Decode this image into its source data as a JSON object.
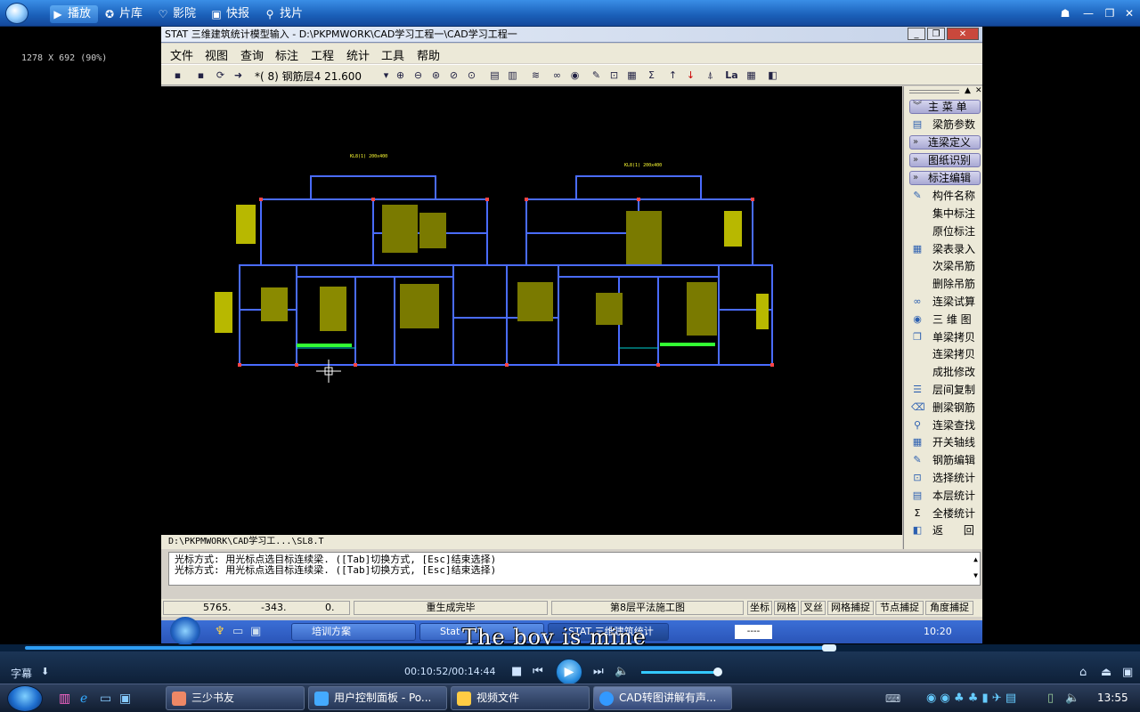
{
  "player": {
    "tabs": [
      {
        "label": "播放",
        "icon": "play-icon"
      },
      {
        "label": "片库",
        "icon": "library-icon"
      },
      {
        "label": "影院",
        "icon": "heart-icon"
      },
      {
        "label": "快报",
        "icon": "news-icon"
      },
      {
        "label": "找片",
        "icon": "search-icon"
      }
    ],
    "resolution": "1278 X 692 (90%)",
    "time": "00:10:52/00:14:44",
    "progress": 0.7375,
    "volume": 0.98,
    "subtitle_label": "字幕",
    "subtitle_text": "The boy is mine"
  },
  "stat": {
    "title": "STAT 三维建筑统计模型输入 - D:\\PKPMWORK\\CAD学习工程一\\CAD学习工程一",
    "menu": [
      "文件",
      "视图",
      "查询",
      "标注",
      "工程",
      "统计",
      "工具",
      "帮助"
    ],
    "layer_text": "*( 8)  钢筋层4   21.600",
    "file_path": "D:\\PKPMWORK\\CAD学习工...\\SL8.T",
    "side_heads": [
      "主 菜 单",
      "连梁定义",
      "图纸识别",
      "标注编辑"
    ],
    "side_first": "梁筋参数",
    "side_items": [
      "构件名称",
      "集中标注",
      "原位标注",
      "梁表录入",
      "次梁吊筋",
      "删除吊筋",
      "连梁试算",
      "三 维 图",
      "单梁拷贝",
      "连梁拷贝",
      "成批修改",
      "层间复制",
      "删梁钢筋",
      "连梁查找",
      "开关轴线",
      "钢筋编辑",
      "选择统计",
      "本层统计",
      "全楼统计",
      "返      回"
    ],
    "command_lines": [
      "光标方式: 用光标点选目标连续梁. ([Tab]切换方式, [Esc]结束选择)",
      "光标方式: 用光标点选目标连续梁. ([Tab]切换方式, [Esc]结束选择)"
    ],
    "coords": [
      "5765.",
      "-343.",
      "0."
    ],
    "status_msg": "重生成完毕",
    "status_layer": "第8层平法施工图",
    "status_toggles": [
      "坐标",
      "网格",
      "叉丝",
      "网格捕捉",
      "节点捕捉",
      "角度捕捉"
    ]
  },
  "inner_taskbar": {
    "tasks": [
      "培训方案",
      "Stat",
      "STAT 三维建筑统计"
    ],
    "input_box": "----",
    "time": "10:20"
  },
  "host_taskbar": {
    "tasks": [
      "三少书友",
      "用户控制面板 - Po...",
      "视频文件",
      "CAD转图讲解有声..."
    ],
    "time": "13:55"
  },
  "colors": {
    "cad_background": "#000000",
    "cad_walls": "#4a6cff",
    "cad_text": "#ffff33",
    "cad_highlight": "#33ff33",
    "player_accent": "#2e9df3"
  }
}
